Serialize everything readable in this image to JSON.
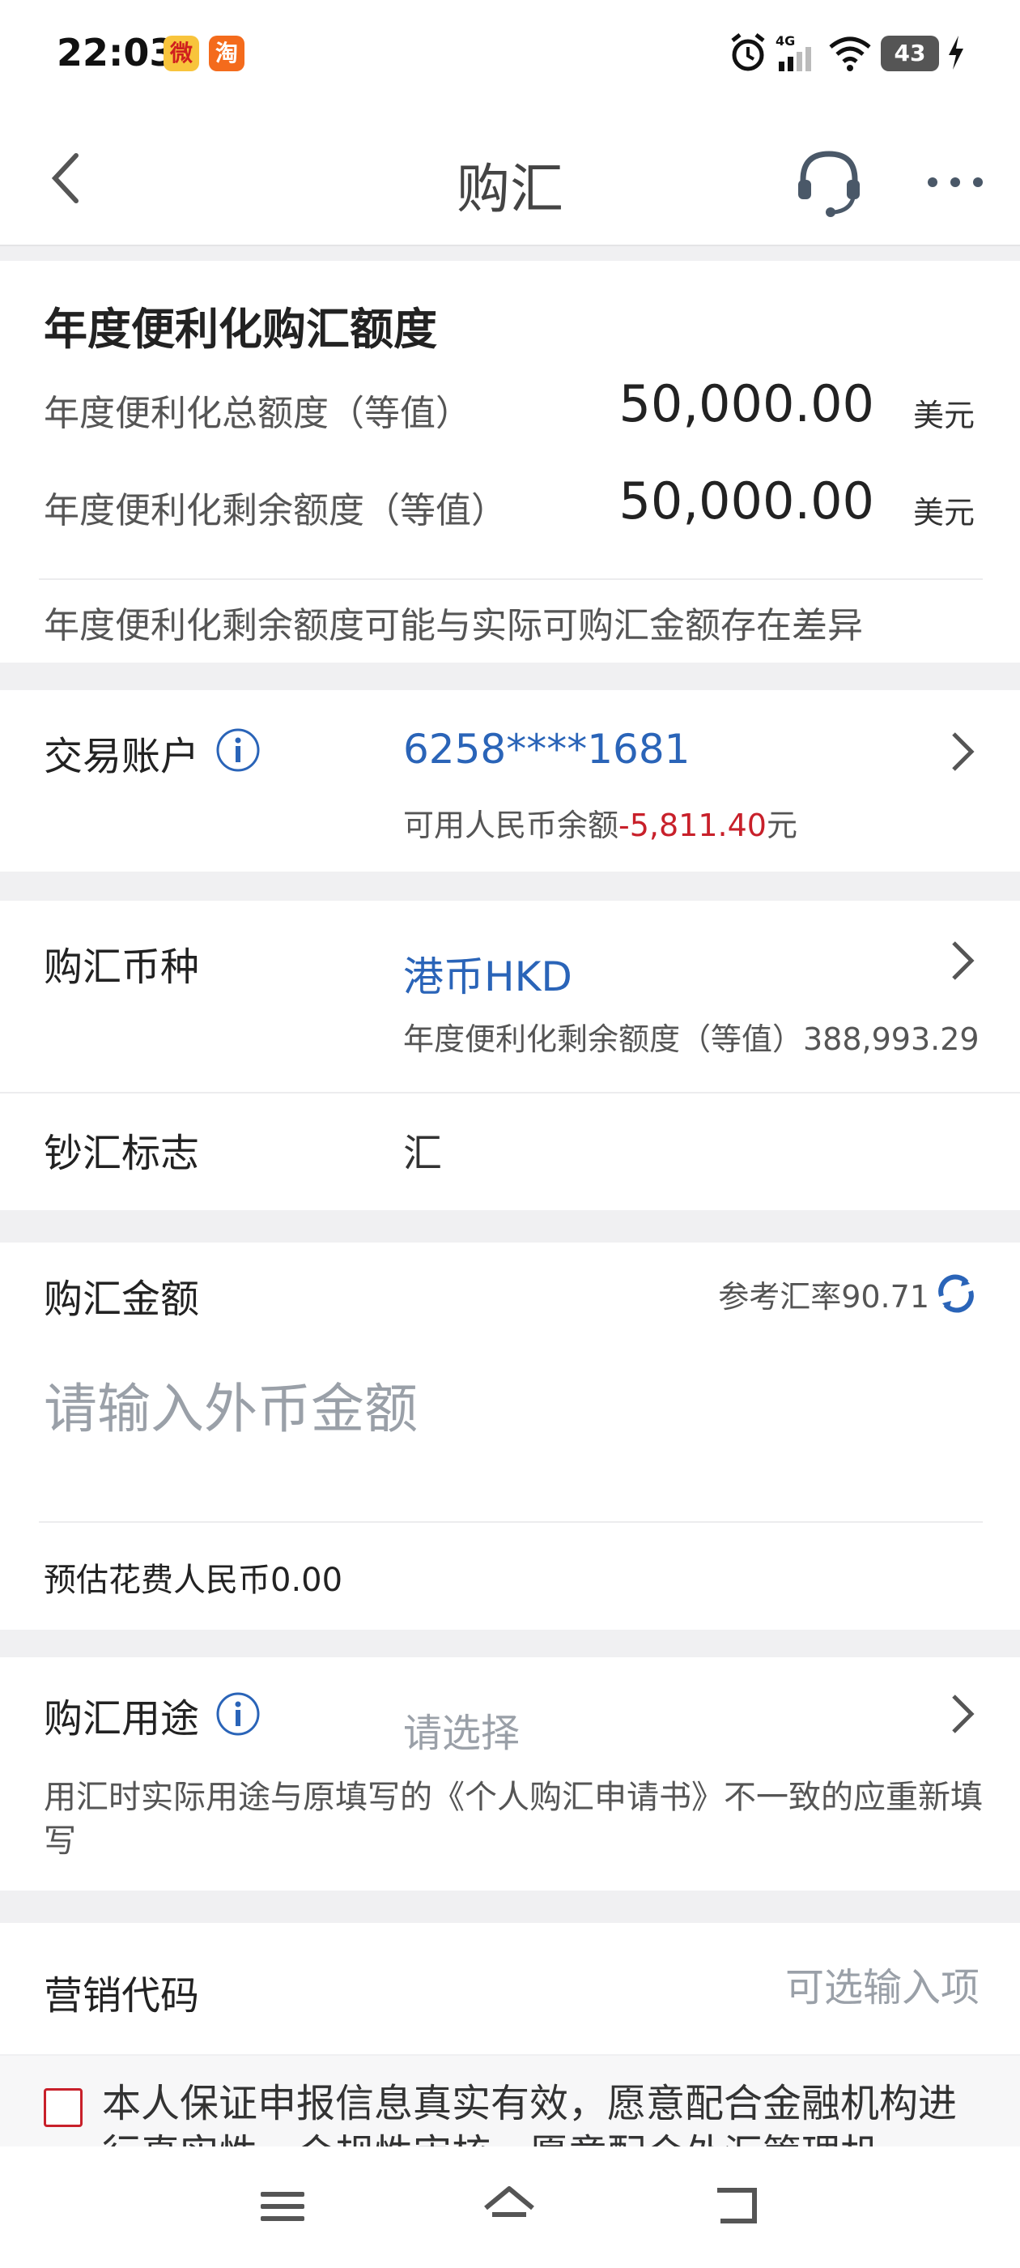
{
  "status_bar": {
    "time": "22:03",
    "weibo_badge": "微",
    "taobao_badge": "淘",
    "network": "4G",
    "battery": "43",
    "icons": [
      "weibo-icon",
      "taobao-icon",
      "alarm-icon",
      "signal-icon",
      "wifi-icon",
      "battery-icon",
      "charging-icon"
    ]
  },
  "header": {
    "title": "购汇",
    "icons": [
      "back-icon",
      "customer-service-icon",
      "more-icon"
    ]
  },
  "quota": {
    "title": "年度便利化购汇额度",
    "total_label": "年度便利化总额度（等值）",
    "total_value": "50,000.00",
    "total_unit": "美元",
    "remaining_label": "年度便利化剩余额度（等值）",
    "remaining_value": "50,000.00",
    "remaining_unit": "美元",
    "note": "年度便利化剩余额度可能与实际可购汇金额存在差异"
  },
  "account": {
    "label": "交易账户",
    "number": "6258****1681",
    "balance_label": "可用人民币余额",
    "balance_value": "-5,811.40",
    "balance_unit": "元"
  },
  "currency": {
    "label": "购汇币种",
    "value": "港币HKD",
    "sub": "年度便利化剩余额度（等值）388,993.29"
  },
  "cash_flag": {
    "label": "钞汇标志",
    "value": "汇"
  },
  "amount": {
    "label": "购汇金额",
    "rate": "参考汇率90.71",
    "placeholder": "请输入外币金额",
    "estimate": "预估花费人民币0.00"
  },
  "purpose": {
    "label": "购汇用途",
    "select_placeholder": "请选择",
    "note": "用汇时实际用途与原填写的《个人购汇申请书》不一致的应重新填写"
  },
  "promo": {
    "label": "营销代码",
    "placeholder": "可选输入项"
  },
  "agreement": {
    "text": "本人保证申报信息真实有效，愿意配合金融机构进行真实性、合规性审核，愿意配合外汇管理机"
  },
  "system_nav": {
    "icons": [
      "menu-icon",
      "home-icon",
      "back-nav-icon"
    ]
  },
  "colors": {
    "link_blue": "#2a64b8",
    "negative_red": "#c8202a",
    "background": "#f0f0f2"
  }
}
